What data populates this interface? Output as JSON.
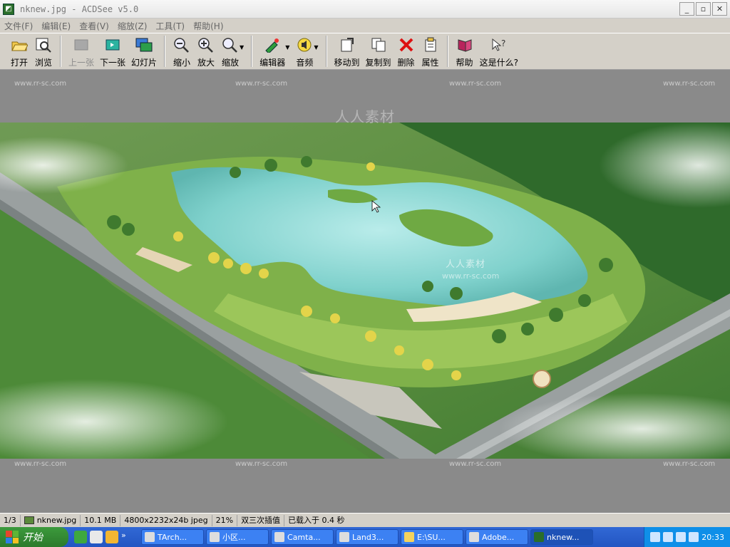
{
  "window": {
    "title": "nknew.jpg - ACDSee v5.0",
    "title_buttons": [
      "_",
      "▫",
      "✕"
    ]
  },
  "menu": [
    "文件(F)",
    "编辑(E)",
    "查看(V)",
    "缩放(Z)",
    "工具(T)",
    "帮助(H)"
  ],
  "toolbar": {
    "open": "打开",
    "browse": "浏览",
    "prev": "上一张",
    "next": "下一张",
    "slideshow": "幻灯片",
    "zoom_out": "缩小",
    "zoom_in": "放大",
    "zoom": "缩放",
    "editor": "编辑器",
    "audio": "音频",
    "move_to": "移动到",
    "copy_to": "复制到",
    "delete": "删除",
    "properties": "属性",
    "help": "帮助",
    "whats_this": "这是什么?"
  },
  "watermarks": {
    "site": "www.rr-sc.com",
    "small": "www.rr-sc.com",
    "label": "人人素材"
  },
  "status": {
    "index": "1/3",
    "filename": "nknew.jpg",
    "size": "10.1 MB",
    "dims": "4800x2232x24b jpeg",
    "zoom": "21%",
    "interp": "双三次插值",
    "load": "已载入于 0.4 秒"
  },
  "taskbar": {
    "start": "开始",
    "tasks": [
      "TArch...",
      "小区...",
      "Camta...",
      "Land3...",
      "E:\\SU...",
      "Adobe...",
      "nknew..."
    ],
    "clock": "20:33"
  },
  "colors": {
    "chrome": "#d4d0c8",
    "viewer_bg": "#8a8a8a",
    "taskbar": "#2356c2",
    "start": "#2c7a2c"
  }
}
